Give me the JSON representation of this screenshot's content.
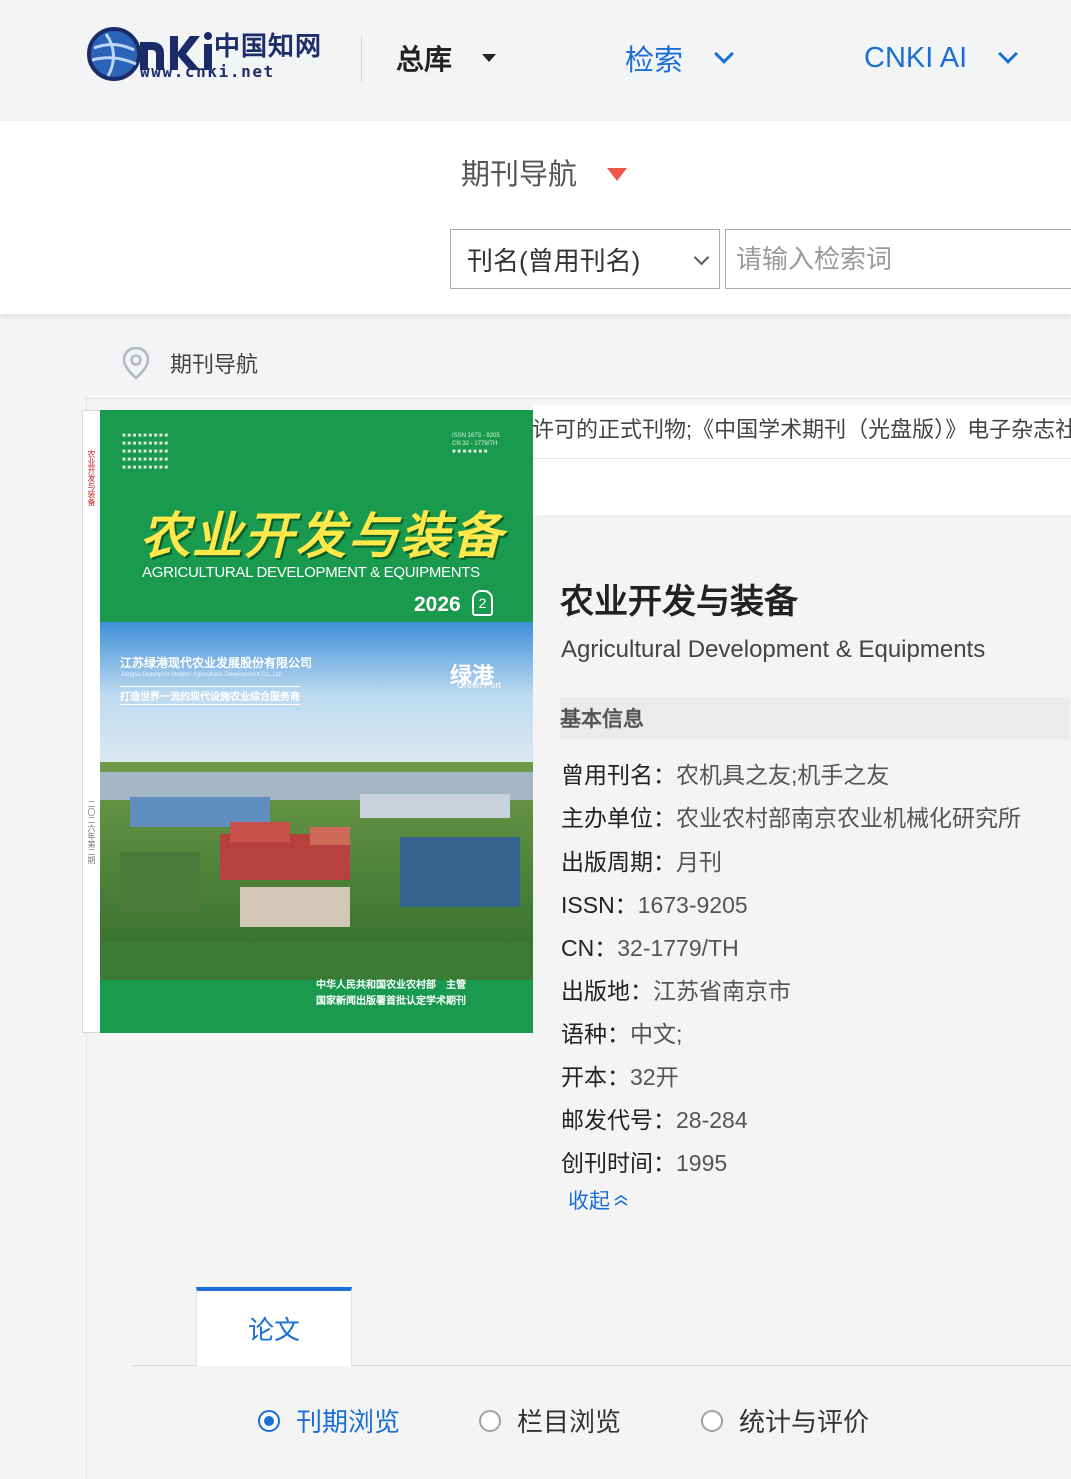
{
  "header": {
    "logo_sub": "www.cnki.net",
    "logo_cn": "中国知网",
    "nav": {
      "zongku": "总库",
      "jiansuo": "检索",
      "cnki_ai": "CNKI AI"
    }
  },
  "search": {
    "nav_label": "期刊导航",
    "field_select": "刊名(曾用刊名)",
    "placeholder": "请输入检索词"
  },
  "breadcrumb": {
    "label": "期刊导航"
  },
  "notice": "许可的正式刊物;《中国学术期刊（光盘版）》电子杂志社",
  "cover": {
    "title_cn": "农业开发与装备",
    "title_en": "AGRICULTURAL DEVELOPMENT & EQUIPMENTS",
    "year": "2026",
    "issue": "2",
    "company_cn": "江苏绿港现代农业发展股份有限公司",
    "company_en": "Jiangsu Greenport Modern Agricultural Development Co.,Ltd.",
    "slogan": "打造世界一流的现代设施农业综合服务商",
    "brand_cn": "绿港",
    "brand_en": "Green Port",
    "sponsor_1": "中华人民共和国农业农村部　主管",
    "sponsor_2": "国家新闻出版署首批认定学术期刊"
  },
  "journal": {
    "title": "农业开发与装备",
    "title_en": "Agricultural Development & Equipments",
    "info_heading": "基本信息",
    "info": [
      {
        "label": "曾用刊名：",
        "value": "农机具之友;机手之友"
      },
      {
        "label": "主办单位：",
        "value": "农业农村部南京农业机械化研究所"
      },
      {
        "label": "出版周期：",
        "value": "月刊"
      },
      {
        "label": "ISSN：",
        "value": "1673-9205"
      },
      {
        "label": "CN：",
        "value": "32-1779/TH"
      },
      {
        "label": "出版地：",
        "value": "江苏省南京市"
      },
      {
        "label": "语种：",
        "value": "中文;"
      },
      {
        "label": "开本：",
        "value": "32开"
      },
      {
        "label": "邮发代号：",
        "value": "28-284"
      },
      {
        "label": "创刊时间：",
        "value": "1995"
      }
    ],
    "collapse_label": "收起"
  },
  "tabs": {
    "active": "论文"
  },
  "browse_options": [
    {
      "label": "刊期浏览",
      "selected": true
    },
    {
      "label": "栏目浏览",
      "selected": false
    },
    {
      "label": "统计与评价",
      "selected": false
    }
  ],
  "colors": {
    "accent": "#1a6fd6",
    "caret_red": "#f0564a",
    "cover_green": "#1a9a4e"
  }
}
